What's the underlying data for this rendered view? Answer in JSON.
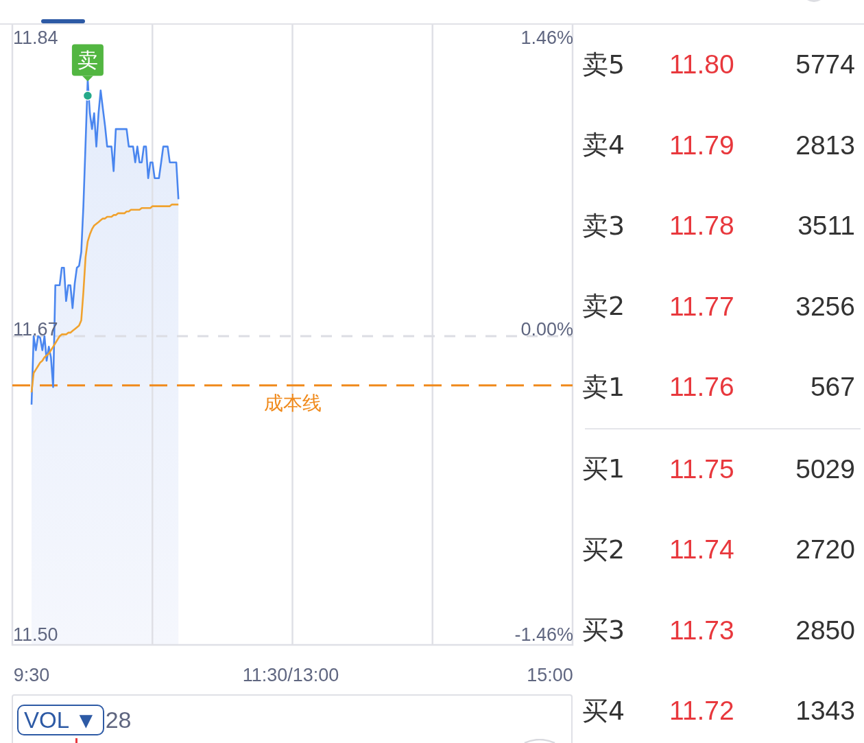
{
  "chart": {
    "right_axis_labels": [
      "1.46%",
      "0.00%",
      "-1.46%"
    ],
    "chart_data": {
      "type": "line",
      "categories": [
        "9:30",
        null,
        null,
        null,
        null,
        null,
        null,
        null,
        null,
        null,
        null,
        null,
        null,
        null,
        null,
        null,
        null,
        null,
        null,
        null,
        null,
        null,
        null,
        null,
        null,
        null,
        null,
        null,
        null,
        null,
        null,
        null,
        null,
        null,
        null,
        null,
        null,
        null,
        null,
        null,
        null,
        null,
        null,
        null,
        null,
        null,
        null,
        null,
        null,
        null,
        null,
        null,
        null,
        null,
        null,
        null,
        null,
        null,
        null,
        null,
        null,
        null,
        null,
        null,
        null,
        null,
        null,
        null,
        null,
        null,
        null,
        null,
        null,
        null,
        null,
        null,
        null,
        null,
        null,
        null,
        null,
        null,
        null,
        null,
        null,
        null,
        null,
        null,
        null,
        null,
        null,
        null,
        null,
        null,
        null,
        null,
        null,
        null,
        null,
        null,
        null,
        null,
        null,
        null,
        null,
        null,
        null,
        null,
        null,
        null,
        null,
        null,
        null,
        null,
        null,
        null,
        null,
        null,
        null,
        null,
        "11:30/13:00",
        null,
        null,
        null,
        null,
        null,
        null,
        null,
        null,
        null,
        null,
        null,
        null,
        null,
        null,
        null,
        null,
        null,
        null,
        null,
        null,
        null,
        null,
        null,
        null,
        null,
        null,
        null,
        null,
        null,
        null,
        null,
        null,
        null,
        null,
        null,
        null,
        null,
        null,
        null,
        null,
        null,
        null,
        null,
        null,
        null,
        null,
        null,
        null,
        null,
        null,
        null,
        null,
        null,
        null,
        null,
        null,
        null,
        null,
        null,
        null,
        null,
        null,
        null,
        null,
        null,
        null,
        null,
        null,
        null,
        null,
        null,
        null,
        null,
        null,
        null,
        null,
        null,
        null,
        null,
        null,
        null,
        null,
        null,
        null,
        null,
        null,
        null,
        null,
        null,
        null,
        null,
        null,
        null,
        null,
        null,
        null,
        null,
        null,
        null,
        null,
        null,
        null,
        null,
        null,
        null,
        null,
        null,
        null,
        null,
        null,
        null,
        null,
        null,
        null,
        null,
        null,
        null,
        null,
        null,
        "15:00"
      ],
      "series": [
        {
          "color": "#4a86ef",
          "values": [
            11.631,
            11.67,
            11.662,
            11.67,
            11.669,
            11.662,
            11.67,
            11.656,
            11.664,
            11.658,
            11.641,
            11.699,
            11.699,
            11.699,
            11.709,
            11.709,
            11.69,
            11.699,
            11.699,
            11.686,
            11.7,
            11.709,
            11.71,
            11.718,
            11.744,
            11.78,
            11.816,
            11.797,
            11.788,
            11.797,
            11.778,
            11.797,
            11.81,
            11.8,
            11.79,
            11.778,
            11.778,
            11.778,
            11.764,
            11.788,
            11.788,
            11.788,
            11.788,
            11.788,
            11.788,
            11.778,
            11.778,
            11.778,
            11.769,
            11.778,
            11.769,
            11.769,
            11.778,
            11.778,
            11.76,
            11.769,
            11.769,
            11.76,
            11.76,
            11.76,
            11.769,
            11.778,
            11.778,
            11.778,
            11.769,
            11.769,
            11.769,
            11.769,
            11.748,
            null,
            null,
            null,
            null,
            null,
            null,
            null,
            null,
            null,
            null,
            null,
            null,
            null,
            null,
            null,
            null,
            null,
            null,
            null,
            null,
            null,
            null,
            null,
            null,
            null,
            null,
            null,
            null,
            null,
            null,
            null,
            null,
            null,
            null,
            null,
            null,
            null,
            null,
            null,
            null,
            null,
            null,
            null,
            null,
            null,
            null,
            null,
            null,
            null,
            null,
            null,
            null,
            null,
            null,
            null,
            null,
            null,
            null,
            null,
            null,
            null,
            null,
            null,
            null,
            null,
            null,
            null,
            null,
            null,
            null,
            null,
            null,
            null,
            null,
            null,
            null,
            null,
            null,
            null,
            null,
            null,
            null,
            null,
            null,
            null,
            null,
            null,
            null,
            null,
            null,
            null,
            null,
            null,
            null,
            null,
            null,
            null,
            null,
            null,
            null,
            null,
            null,
            null,
            null,
            null,
            null,
            null,
            null,
            null,
            null,
            null,
            null,
            null,
            null,
            null,
            null,
            null,
            null,
            null,
            null,
            null,
            null,
            null,
            null,
            null,
            null,
            null,
            null,
            null,
            null,
            null,
            null,
            null,
            null,
            null,
            null,
            null,
            null,
            null,
            null,
            null,
            null,
            null,
            null,
            null,
            null,
            null,
            null,
            null,
            null,
            null,
            null,
            null,
            null,
            null,
            null,
            null,
            null,
            null,
            null,
            null,
            null,
            null,
            null,
            null,
            null,
            null,
            null,
            null,
            null,
            null,
            null
          ]
        },
        {
          "color": "#f0a22e",
          "values": [
            11.638,
            11.649,
            11.651,
            11.653,
            11.655,
            11.656,
            11.658,
            11.659,
            11.66,
            11.662,
            11.664,
            11.666,
            11.668,
            11.67,
            11.671,
            11.671,
            11.671,
            11.672,
            11.672,
            11.673,
            11.674,
            11.675,
            11.676,
            11.679,
            11.695,
            11.715,
            11.724,
            11.728,
            11.731,
            11.733,
            11.734,
            11.735,
            11.736,
            11.737,
            11.737,
            11.738,
            11.738,
            11.738,
            11.739,
            11.739,
            11.74,
            11.74,
            11.74,
            11.74,
            11.741,
            11.741,
            11.742,
            11.742,
            11.742,
            11.742,
            11.742,
            11.743,
            11.743,
            11.743,
            11.743,
            11.743,
            11.744,
            11.744,
            11.744,
            11.744,
            11.744,
            11.744,
            11.744,
            11.744,
            11.744,
            11.745,
            11.745,
            11.745,
            11.745,
            null,
            null,
            null,
            null,
            null,
            null,
            null,
            null,
            null,
            null,
            null,
            null,
            null,
            null,
            null,
            null,
            null,
            null,
            null,
            null,
            null,
            null,
            null,
            null,
            null,
            null,
            null,
            null,
            null,
            null,
            null,
            null,
            null,
            null,
            null,
            null,
            null,
            null,
            null,
            null,
            null,
            null,
            null,
            null,
            null,
            null,
            null,
            null,
            null,
            null,
            null,
            null,
            null,
            null,
            null,
            null,
            null,
            null,
            null,
            null,
            null,
            null,
            null,
            null,
            null,
            null,
            null,
            null,
            null,
            null,
            null,
            null,
            null,
            null,
            null,
            null,
            null,
            null,
            null,
            null,
            null,
            null,
            null,
            null,
            null,
            null,
            null,
            null,
            null,
            null,
            null,
            null,
            null,
            null,
            null,
            null,
            null,
            null,
            null,
            null,
            null,
            null,
            null,
            null,
            null,
            null,
            null,
            null,
            null,
            null,
            null,
            null,
            null,
            null,
            null,
            null,
            null,
            null,
            null,
            null,
            null,
            null,
            null,
            null,
            null,
            null,
            null,
            null,
            null,
            null,
            null,
            null,
            null,
            null,
            null,
            null,
            null,
            null,
            null,
            null,
            null,
            null,
            null,
            null,
            null,
            null,
            null,
            null,
            null,
            null,
            null,
            null,
            null,
            null,
            null,
            null,
            null,
            null,
            null,
            null,
            null,
            null,
            null,
            null,
            null,
            null,
            null,
            null,
            null,
            null,
            null,
            null
          ]
        }
      ],
      "ylim": [
        11.5,
        11.84
      ],
      "yticks": [
        {
          "value": 11.84,
          "label": "11.84"
        },
        {
          "value": 11.67,
          "label": "11.67"
        },
        {
          "value": 11.5,
          "label": "11.50"
        }
      ],
      "ref_lines": [
        {
          "axis": "y",
          "value": 11.67
        },
        {
          "axis": "y",
          "value": 11.642,
          "label": "成本线"
        }
      ],
      "annotations": [
        {
          "y": 11.807,
          "text": "卖"
        }
      ]
    }
  },
  "vol_panel": {
    "indicator_button": "VOL ▼",
    "value": "28"
  },
  "order_book": {
    "asks": [
      {
        "label": "卖5",
        "price": "11.80",
        "volume": "5774"
      },
      {
        "label": "卖4",
        "price": "11.79",
        "volume": "2813"
      },
      {
        "label": "卖3",
        "price": "11.78",
        "volume": "3511"
      },
      {
        "label": "卖2",
        "price": "11.77",
        "volume": "3256"
      },
      {
        "label": "卖1",
        "price": "11.76",
        "volume": "567"
      }
    ],
    "bids": [
      {
        "label": "买1",
        "price": "11.75",
        "volume": "5029"
      },
      {
        "label": "买2",
        "price": "11.74",
        "volume": "2720"
      },
      {
        "label": "买3",
        "price": "11.73",
        "volume": "2850"
      },
      {
        "label": "买4",
        "price": "11.72",
        "volume": "1343"
      }
    ]
  }
}
